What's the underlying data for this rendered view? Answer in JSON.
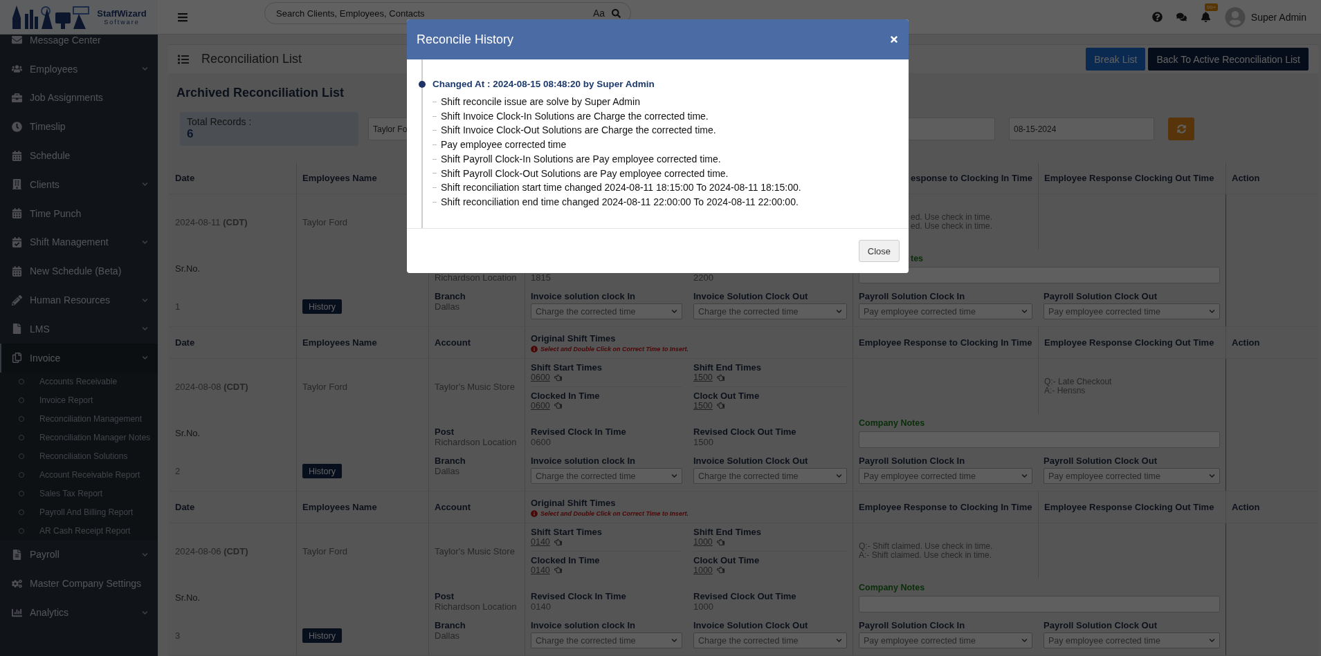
{
  "logo": {
    "name": "StaffWizard",
    "tagline": "Software"
  },
  "topbar": {
    "search_placeholder": "Search Clients, Employees, Contacts",
    "case_toggle": "Aa",
    "notification_count": "99+",
    "user_name": "Super Admin"
  },
  "sidebar": {
    "items": [
      {
        "label": "Message Center",
        "selected": false
      },
      {
        "label": "Employees",
        "selected": false,
        "expanded": false
      },
      {
        "label": "Job Assignments",
        "selected": false
      },
      {
        "label": "Timeslip",
        "selected": false
      },
      {
        "label": "Schedule",
        "selected": false
      },
      {
        "label": "Clients",
        "selected": false,
        "expanded": false
      },
      {
        "label": "Time Punch",
        "selected": false
      },
      {
        "label": "Shift Management",
        "selected": false,
        "expanded": false
      },
      {
        "label": "New Schedule (Beta)",
        "selected": false
      },
      {
        "label": "Human Resources",
        "selected": false,
        "expanded": false
      },
      {
        "label": "LMS",
        "selected": false,
        "expanded": false
      },
      {
        "label": "Invoice",
        "selected": true,
        "expanded": true,
        "children": [
          {
            "label": "Accounts Receivable"
          },
          {
            "label": "Invoice Report"
          },
          {
            "label": "Reconciliation Management"
          },
          {
            "label": "Reconciliation Manager Notes"
          },
          {
            "label": "Reconciliation Solutions"
          },
          {
            "label": "Account Receivable Report"
          },
          {
            "label": "Sales Tax Report"
          },
          {
            "label": "Payroll And Billing Report"
          },
          {
            "label": "AR Cash Receipt Report"
          }
        ]
      },
      {
        "label": "Payroll",
        "selected": false,
        "expanded": false
      },
      {
        "label": "Master Company Settings",
        "selected": false
      },
      {
        "label": "Analytics",
        "selected": false,
        "expanded": false
      }
    ]
  },
  "page": {
    "title": "Reconciliation List",
    "buttons": [
      {
        "label": "Break List",
        "kind": "primary"
      },
      {
        "label": "Back To Active Reconciliation List",
        "kind": "dark"
      }
    ],
    "subtitle": "Archived Reconciliation List",
    "total_label": "Total Records :",
    "total_value": "6",
    "filters": [
      {
        "value": "Taylor Fo"
      },
      {
        "value": "08-15-2024"
      }
    ]
  },
  "records": [
    {
      "header": {
        "date": "Date",
        "employee": "Employees Name",
        "response_in": {
          "text": "esponse to Clocking In Time",
          "kind": "clipped"
        },
        "response_out": "Employee Response Clocking Out Time",
        "action": "Action"
      },
      "date": "2024-08-11",
      "tz": "(CDT)",
      "employee": "Taylor Ford",
      "response_in": {
        "kind": "clipped",
        "lines": [
          "ed. Use check in time.",
          "ed. Use check in time."
        ]
      },
      "sr_label": "Sr.No.",
      "post": {
        "value": "Richardson Location"
      },
      "revised_in": {
        "value": "1815"
      },
      "revised_out": {
        "value": "2200"
      },
      "notes_label": {
        "text": "tes",
        "kind": "clipped"
      },
      "sr": "1",
      "history": "History",
      "branch": {
        "label": "Branch",
        "value": "Dallas"
      },
      "invoice_in": {
        "label": "Invoice solution clock In",
        "value": "Charge the corrected time"
      },
      "invoice_out": {
        "label": "Invoice Solution Clock Out",
        "value": "Charge the corrected time"
      },
      "payroll_in": {
        "label": "Payroll Solution Clock In",
        "value": "Pay employee corrected time"
      },
      "payroll_out": {
        "label": "Payroll Solution Clock Out",
        "value": "Pay employee corrected time"
      }
    },
    {
      "header": {
        "date": "Date",
        "employee": "Employees Name",
        "account": "Account",
        "original": "Original Shift Times",
        "note": "Select and Double Click on Correct Time to Insert.",
        "response_in": {
          "text": "Employee Response to Clocking In Time",
          "kind": "full"
        },
        "response_out": "Employee Response Clocking Out Time",
        "action": "Action"
      },
      "date": "2024-08-08",
      "tz": "(CDT)",
      "employee": "Taylor Ford",
      "account": "Taylor's Music Store",
      "shift_start": {
        "label": "Shift Start Times",
        "value": "0600"
      },
      "shift_end": {
        "label": "Shift End Times",
        "value": "1500"
      },
      "clocked_in": {
        "label": "Clocked In Time",
        "value": "0600"
      },
      "clock_out": {
        "label": "Clock Out Time",
        "value": "1500"
      },
      "response_out": {
        "lines": [
          "Q:- Late Checkout",
          "A:- Hensns"
        ]
      },
      "sr_label": "Sr.No.",
      "post": {
        "label": "Post",
        "value": "Richardson Location"
      },
      "revised_in": {
        "label": "Revised Clock In Time",
        "value": "0600"
      },
      "revised_out": {
        "label": "Revised Clock Out Time",
        "value": "1500"
      },
      "notes_label": {
        "text": "Company Notes",
        "kind": "full"
      },
      "sr": "2",
      "history": "History",
      "branch": {
        "label": "Branch",
        "value": "Dallas"
      },
      "invoice_in": {
        "label": "Invoice solution clock In",
        "value": "Charge the corrected time"
      },
      "invoice_out": {
        "label": "Invoice Solution Clock Out",
        "value": "Charge the corrected time"
      },
      "payroll_in": {
        "label": "Payroll Solution Clock In",
        "value": "Pay employee corrected time"
      },
      "payroll_out": {
        "label": "Payroll Solution Clock Out",
        "value": "Pay employee corrected time"
      }
    },
    {
      "header": {
        "date": "Date",
        "employee": "Employees Name",
        "account": "Account",
        "original": "Original Shift Times",
        "note": "Select and Double Click on Correct Time to Insert.",
        "response_in": {
          "text": "Employee Response to Clocking In Time",
          "kind": "full"
        },
        "response_out": "Employee Response Clocking Out Time",
        "action": "Action"
      },
      "date": "2024-08-06",
      "tz": "(CDT)",
      "employee": "Taylor Ford",
      "account": "Taylor's Music Store",
      "shift_start": {
        "label": "Shift Start Times",
        "value": "0140"
      },
      "shift_end": {
        "label": "Shift End Times",
        "value": "1000"
      },
      "clocked_in": {
        "label": "Clocked In Time",
        "value": "0140"
      },
      "clock_out": {
        "label": "Clock Out Time",
        "value": "1000"
      },
      "response_in": {
        "kind": "full",
        "lines": [
          "Q:- Shift claimed. Use check in time.",
          "A:- Shift claimed. Use check in time."
        ]
      },
      "sr_label": "Sr.No.",
      "post": {
        "label": "Post",
        "value": "Richardson Location"
      },
      "revised_in": {
        "label": "Revised Clock In Time",
        "value": "0140"
      },
      "revised_out": {
        "label": "Revised Clock Out Time",
        "value": "1000"
      },
      "notes_label": {
        "text": "Company Notes",
        "kind": "full"
      },
      "sr": "3",
      "history": "History",
      "branch": {
        "label": "Branch",
        "value": "Dallas"
      },
      "invoice_in": {
        "label": "Invoice solution clock In",
        "value": "Charge the corrected time"
      },
      "invoice_out": {
        "label": "Invoice Solution Clock Out",
        "value": "Charge the corrected time"
      },
      "payroll_in": {
        "label": "Payroll Solution Clock In",
        "value": "Pay employee corrected time"
      },
      "payroll_out": {
        "label": "Payroll Solution Clock Out",
        "value": "Pay employee corrected time"
      }
    }
  ],
  "modal": {
    "title": "Reconcile History",
    "entries": [
      {
        "heading": "Changed At : 2024-08-15 08:48:20 by Super Admin",
        "items": [
          "Shift reconcile issue are solve by Super Admin",
          "Shift Invoice Clock-In Solutions are Charge the corrected time.",
          "Shift Invoice Clock-Out Solutions are Charge the corrected time.",
          "Pay employee corrected time",
          "Shift Payroll Clock-In Solutions are Pay employee corrected time.",
          "Shift Payroll Clock-Out Solutions are Pay employee corrected time.",
          "Shift reconciliation start time changed 2024-08-11 18:15:00 To 2024-08-11 18:15:00.",
          "Shift reconciliation end time changed 2024-08-11 22:00:00 To 2024-08-11 22:00:00."
        ]
      }
    ],
    "close_label": "Close"
  }
}
